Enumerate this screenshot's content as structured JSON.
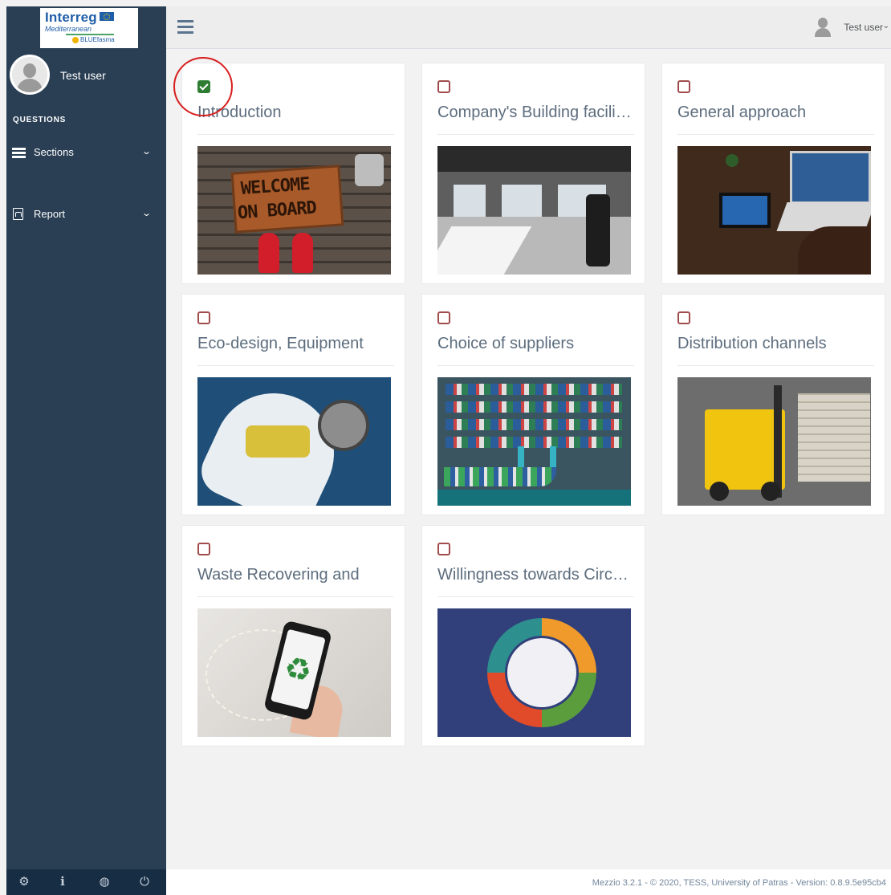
{
  "sidebar": {
    "logo": {
      "brand": "Interreg",
      "program": "Mediterranean",
      "project": "BLUEfasma"
    },
    "user": {
      "name": "Test user"
    },
    "heading": "QUESTIONS",
    "items": [
      {
        "label": "Sections",
        "icon": "list-icon"
      },
      {
        "label": "Report",
        "icon": "pdf-icon"
      }
    ],
    "footer_icons": [
      "settings-icon",
      "info-icon",
      "globe-icon",
      "power-icon"
    ]
  },
  "topbar": {
    "user_name": "Test user"
  },
  "cards": [
    {
      "title": "Introduction",
      "checked": true,
      "image": "welcome-on-board"
    },
    {
      "title": "Company's Building facilities",
      "checked": false,
      "image": "office-interior"
    },
    {
      "title": "General approach",
      "checked": false,
      "image": "circular-economy-laptop"
    },
    {
      "title": "Eco-design, Equipment",
      "checked": false,
      "image": "fishing-boat"
    },
    {
      "title": "Choice of suppliers",
      "checked": false,
      "image": "container-port"
    },
    {
      "title": "Distribution channels",
      "checked": false,
      "image": "forklift-warehouse"
    },
    {
      "title": "Waste Recovering and",
      "checked": false,
      "image": "recycling-phone"
    },
    {
      "title": "Willingness towards Circular Economy",
      "checked": false,
      "image": "circular-diagram"
    }
  ],
  "footer": {
    "text": "Mezzio 3.2.1 - © 2020, TESS, University of Patras - Version: 0.8.9.5e95cb4"
  },
  "colors": {
    "sidebar_bg": "#2a3f54",
    "checked": "#2e7d32",
    "unchecked_border": "#a14c4c",
    "annotation": "#d81e1e"
  }
}
